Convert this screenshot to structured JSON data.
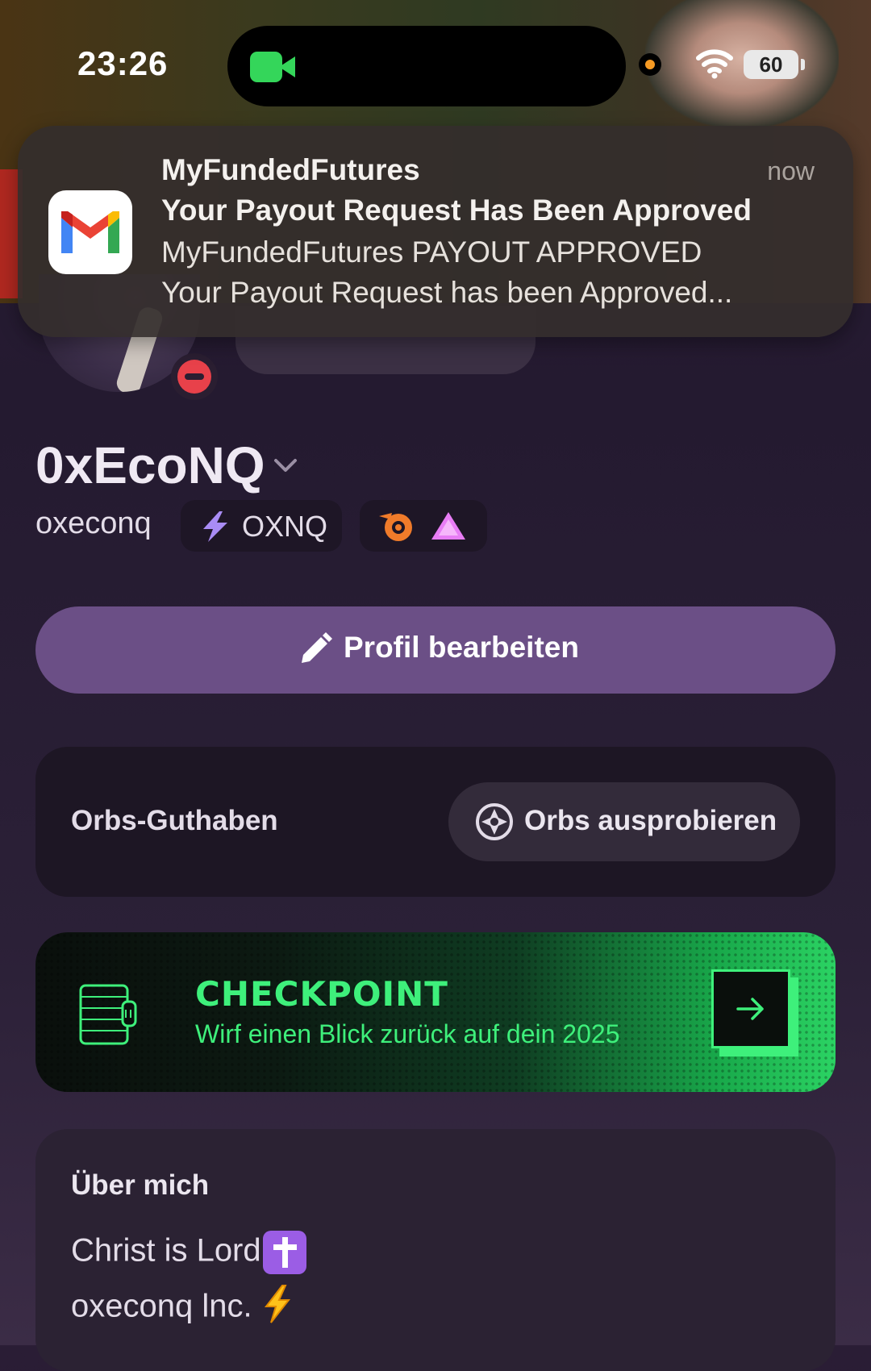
{
  "status_bar": {
    "time": "23:26",
    "battery": "60",
    "icons": [
      "camera-active-icon",
      "mic-indicator-icon",
      "wifi-icon",
      "battery-icon"
    ]
  },
  "notification": {
    "app_icon": "gmail-icon",
    "app": "MyFundedFutures",
    "time": "now",
    "title": "Your Payout Request Has Been Approved",
    "body_line1": "MyFundedFutures PAYOUT APPROVED",
    "body_line2": "Your Payout Request has been Approved..."
  },
  "profile": {
    "display_name": "0xEcoNQ",
    "username": "oxeconq",
    "clan_tag": "OXNQ",
    "status": "do-not-disturb",
    "badges": [
      "orbs-badge-icon",
      "triangle-badge-icon"
    ]
  },
  "edit_button": {
    "label": "Profil bearbeiten",
    "icon": "pencil-icon"
  },
  "orbs": {
    "label": "Orbs-Guthaben",
    "button_label": "Orbs ausprobieren",
    "button_icon": "orb-icon"
  },
  "checkpoint": {
    "title": "CHECKPOINT",
    "subtitle": "Wirf einen Blick zurück auf dein 2025",
    "icon": "checkpoint-icon",
    "arrow_icon": "arrow-right-icon"
  },
  "about": {
    "title": "Über mich",
    "line1": "Christ is Lord",
    "line1_emoji": "latin-cross-emoji",
    "line2": "oxeconq lnc.",
    "line2_emoji": "lightning-emoji"
  },
  "colors": {
    "accent_purple": "#6b4f86",
    "checkpoint_green": "#3ef07b",
    "dnd_red": "#e8414a"
  }
}
